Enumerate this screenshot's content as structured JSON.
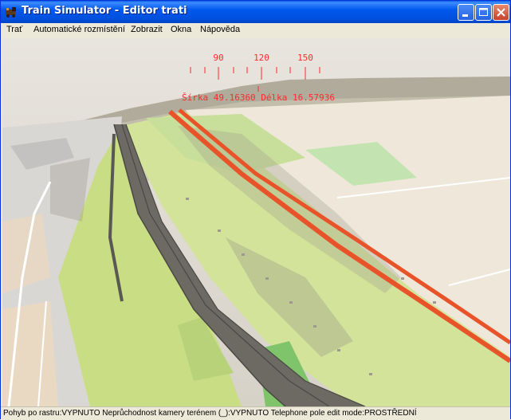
{
  "window": {
    "title": "Train Simulator - Editor trati"
  },
  "menu": [
    {
      "label": "Trať"
    },
    {
      "label": "Automatické rozmístění"
    },
    {
      "label": "Zobrazit"
    },
    {
      "label": "Okna"
    },
    {
      "label": "Nápověda"
    }
  ],
  "compass": {
    "ticks": [
      "90",
      "120",
      "150"
    ]
  },
  "coords": "Šírka 49.16360 Délka 16.57936",
  "status": "Pohyb po rastru:VYPNUTO Neprůchodnost kamery terénem (_):VYPNUTO Telephone pole edit mode:PROSTŘEDNÍ",
  "colors": {
    "overlay_red": "#ff2a2a",
    "rail_orange": "#e8532a",
    "field_green": "#c9dd84",
    "titlebar_blue": "#0058ee"
  }
}
